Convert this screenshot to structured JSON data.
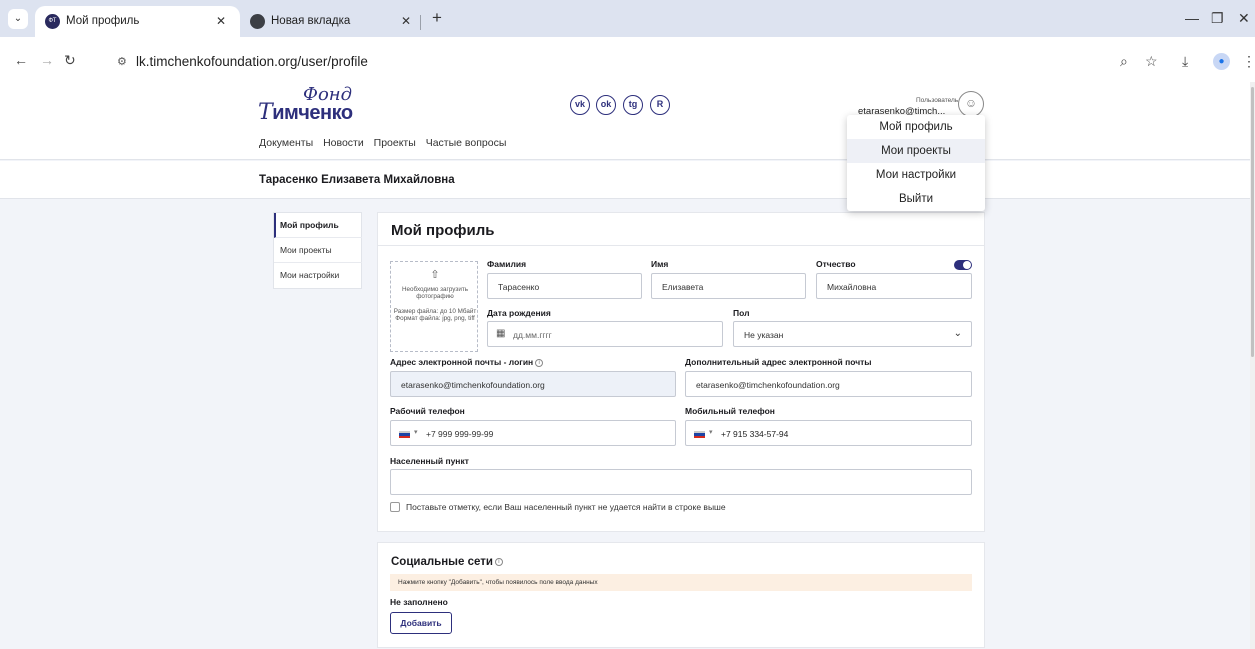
{
  "browser": {
    "tabs": [
      {
        "title": "Мой профиль",
        "favicon": "fond-logo-icon",
        "active": true
      },
      {
        "title": "Новая вкладка",
        "favicon": "globe-icon",
        "active": false
      }
    ],
    "url": "lk.timchenkofoundation.org/user/profile"
  },
  "site": {
    "logo": {
      "top": "Фонд",
      "main_initial": "Т",
      "main_rest": "имченко"
    },
    "nav": [
      "Документы",
      "Новости",
      "Проекты",
      "Частые вопросы"
    ],
    "social": [
      "vk-icon",
      "odnoklassniki-icon",
      "telegram-icon",
      "rutube-icon"
    ],
    "social_glyphs": [
      "vk",
      "ok",
      "tg",
      "R"
    ],
    "user": {
      "role": "Пользователь",
      "email": "etarasenko@timch..."
    }
  },
  "user_menu": [
    "Мой профиль",
    "Мои проекты",
    "Мои настройки",
    "Выйти"
  ],
  "full_name": "Тарасенко Елизавета Михайловна",
  "side_menu": [
    "Мой профиль",
    "Мои проекты",
    "Мои настройки"
  ],
  "profile": {
    "title": "Мой профиль",
    "upload": {
      "line1": "Необходимо загрузить фотографию",
      "line2": "Размер файла: до 10 Мбайт Формат файла: jpg, png, tiff"
    },
    "fields": {
      "last_name": {
        "label": "Фамилия",
        "value": "Тарасенко"
      },
      "first_name": {
        "label": "Имя",
        "value": "Елизавета"
      },
      "patronymic": {
        "label": "Отчество",
        "value": "Михайловна"
      },
      "birth_date": {
        "label": "Дата рождения",
        "placeholder": "дд.мм.гггг"
      },
      "gender": {
        "label": "Пол",
        "value": "Не указан"
      },
      "email": {
        "label": "Адрес электронной почты - логин",
        "value": "etarasenko@timchenkofoundation.org"
      },
      "extra_email": {
        "label": "Дополнительный адрес электронной почты",
        "value": "etarasenko@timchenkofoundation.org"
      },
      "work_phone": {
        "label": "Рабочий телефон",
        "value": "+7 999 999-99-99"
      },
      "mobile_phone": {
        "label": "Мобильный телефон",
        "value": "+7 915 334-57-94"
      },
      "city": {
        "label": "Населенный пункт",
        "value": ""
      }
    },
    "checkbox_label": "Поставьте отметку, если Ваш населенный пункт не удается найти в строке выше"
  },
  "social_section": {
    "title": "Социальные сети",
    "hint": "Нажмите кнопку \"Добавить\", чтобы появилось поле ввода данных",
    "status": "Не заполнено",
    "add_button": "Добавить"
  },
  "colors": {
    "brand": "#2d2f7c",
    "hint_bg": "#fcefe2",
    "page_bg": "#f2f4f9"
  }
}
